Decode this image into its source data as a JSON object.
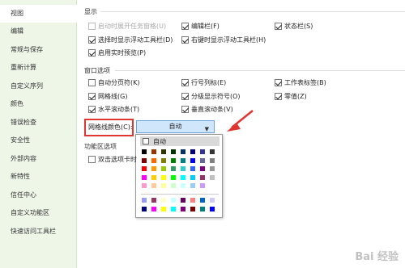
{
  "sidebar": {
    "items": [
      {
        "label": "视图",
        "active": true
      },
      {
        "label": "编辑"
      },
      {
        "label": "常规与保存"
      },
      {
        "label": "重新计算"
      },
      {
        "label": "自定义序列"
      },
      {
        "label": "颜色"
      },
      {
        "label": "错误检查"
      },
      {
        "label": "安全性"
      },
      {
        "label": "外部内容"
      },
      {
        "label": "新特性"
      },
      {
        "label": "信任中心"
      },
      {
        "label": "自定义功能区"
      },
      {
        "label": "快速访问工具栏"
      }
    ]
  },
  "display": {
    "title": "显示",
    "options": [
      {
        "label": "启动时展开任务窗格(U)",
        "checked": false,
        "disabled": true
      },
      {
        "label": "编辑栏(F)",
        "checked": true
      },
      {
        "label": "状态栏(S)",
        "checked": true
      },
      {
        "label": "选择时显示浮动工具栏(D)",
        "checked": true
      },
      {
        "label": "右键时显示浮动工具栏(H)",
        "checked": true
      },
      {
        "label": "启用实时预览(P)",
        "checked": true
      }
    ]
  },
  "window": {
    "title": "窗口选项",
    "options": [
      {
        "label": "自动分页符(K)",
        "checked": false
      },
      {
        "label": "行号列标(E)",
        "checked": true
      },
      {
        "label": "工作表标签(B)",
        "checked": true
      },
      {
        "label": "网格线(G)",
        "checked": true
      },
      {
        "label": "分级显示符号(O)",
        "checked": true
      },
      {
        "label": "零值(Z)",
        "checked": true
      },
      {
        "label": "水平滚动条(T)",
        "checked": true
      },
      {
        "label": "垂直滚动条(V)",
        "checked": true
      }
    ],
    "gridcolor_label": "网格线颜色(C):",
    "gridcolor_value": "自动"
  },
  "ribbon": {
    "title": "功能区选项",
    "options": [
      {
        "label": "双击选项卡时",
        "checked": false
      }
    ]
  },
  "color_popup": {
    "auto_label": "自动",
    "palette_rows": [
      [
        "#000000",
        "#993300",
        "#333300",
        "#003300",
        "#003366",
        "#000080",
        "#333399",
        "#333333"
      ],
      [
        "#800000",
        "#FF6600",
        "#808000",
        "#008000",
        "#008080",
        "#0000FF",
        "#666699",
        "#808080"
      ],
      [
        "#FF0000",
        "#FF9900",
        "#99CC00",
        "#339966",
        "#33CCCC",
        "#3366FF",
        "#800080",
        "#969696"
      ],
      [
        "#FF00FF",
        "#FFCC00",
        "#FFFF00",
        "#00FF00",
        "#00FFFF",
        "#00CCFF",
        "#993366",
        "#C0C0C0"
      ],
      [
        "#FF99CC",
        "#FFCC99",
        "#FFFF99",
        "#CCFFCC",
        "#CCFFFF",
        "#99CCFF",
        "#CC99FF",
        "#FFFFFF"
      ]
    ],
    "extra_rows": [
      [
        "#9999FF",
        "#993366",
        "#FFFFCC",
        "#CCFFFF",
        "#660066",
        "#FF8080",
        "#0066CC",
        "#CCCCFF"
      ],
      [
        "#000080",
        "#FF00FF",
        "#FFFF00",
        "#00FFFF",
        "#800080",
        "#800000",
        "#008080",
        "#0000FF"
      ]
    ]
  },
  "colors": {
    "sidebar_bg": "#eef6e8",
    "highlight_border": "#e0362f",
    "arrow": "#e0362f",
    "select_bg": "#cfe6fb"
  },
  "icons": {
    "dropdown": "chevron-down-icon",
    "arrow": "annotation-arrow-icon"
  },
  "watermark": "Bai 经验"
}
